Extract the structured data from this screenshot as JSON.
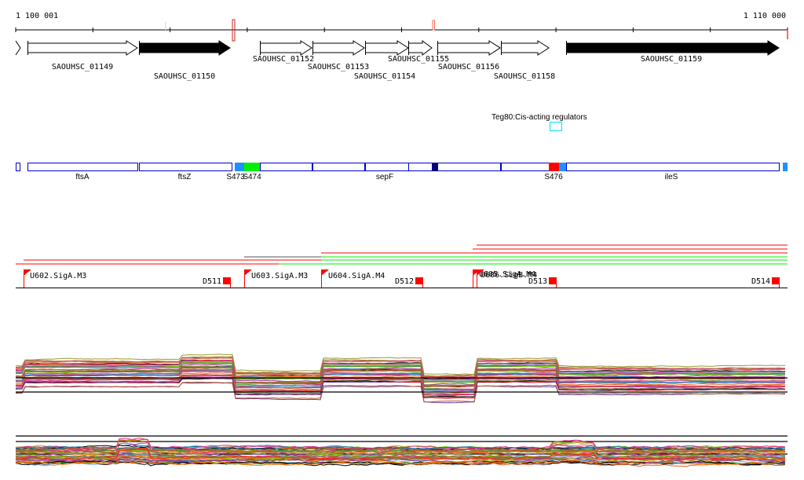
{
  "ruler": {
    "start_label": "1 100 001",
    "end_label": "1 110 000"
  },
  "genes": [
    {
      "name": "SAOUHSC_01149",
      "fill": "#ffffff"
    },
    {
      "name": "SAOUHSC_01150",
      "fill": "#000000"
    },
    {
      "name": "SAOUHSC_01152",
      "fill": "#ffffff"
    },
    {
      "name": "SAOUHSC_01153",
      "fill": "#ffffff"
    },
    {
      "name": "SAOUHSC_01154",
      "fill": "#ffffff"
    },
    {
      "name": "SAOUHSC_01155",
      "fill": "#ffffff"
    },
    {
      "name": "SAOUHSC_01156",
      "fill": "#ffffff"
    },
    {
      "name": "SAOUHSC_01158",
      "fill": "#ffffff"
    },
    {
      "name": "SAOUHSC_01159",
      "fill": "#000000"
    }
  ],
  "regulator": {
    "label": "Teg80:Cis-acting regulators",
    "color": "#00e5ee"
  },
  "transcripts": {
    "labels": [
      "ftsA",
      "ftsZ",
      "S473",
      "S474",
      "sepF",
      "S476",
      "ileS"
    ],
    "outline_color": "#0000cc",
    "segment_colors": {
      "S473": "#1e90ff",
      "S474": "#00ee00",
      "navy": "#000080",
      "S476": "#ff0000",
      "blue": "#1e90ff"
    }
  },
  "tss": {
    "up": [
      "U602.SigA.M3",
      "U603.SigA.M3",
      "U604.SigA.M4",
      "U605.SigA.M4",
      "U606.SigB.M4"
    ],
    "down": [
      "D511",
      "D512",
      "D513",
      "D514"
    ],
    "color": "#ff0000"
  },
  "expression": {
    "palette": [
      "#7fd000",
      "#8b7d2a",
      "#e06020",
      "#a03090",
      "#ff2020",
      "#000000",
      "#60b0f0",
      "#d04080",
      "#c07030",
      "#6a3d9a",
      "#33a02c",
      "#b15928",
      "#e7298a",
      "#1f78b4",
      "#ff7f00",
      "#999933"
    ]
  }
}
